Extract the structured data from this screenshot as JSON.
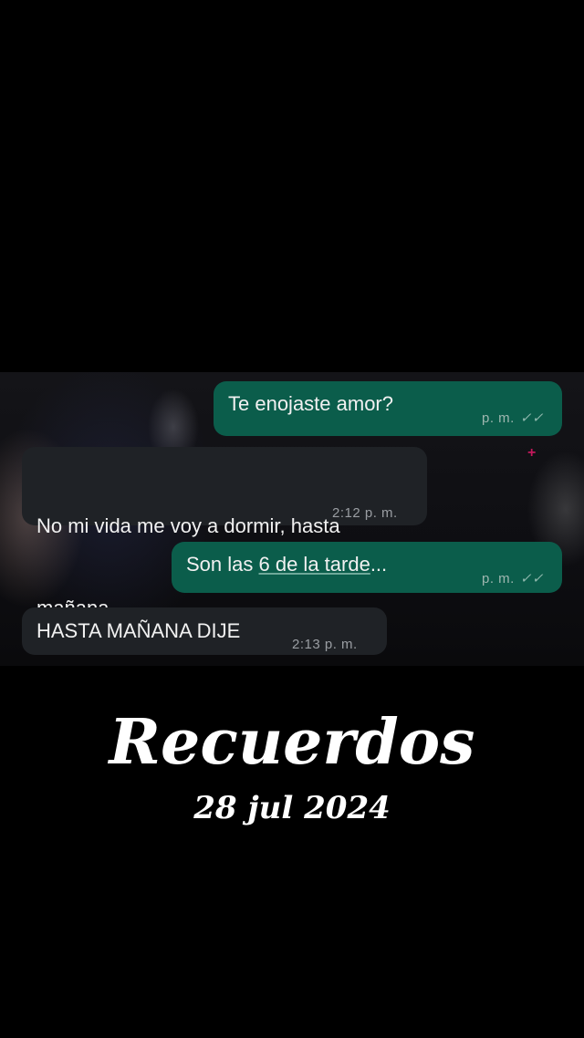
{
  "chat": {
    "messages": [
      {
        "direction": "outgoing",
        "text": "Te enojaste amor?",
        "time": "p. m.",
        "status_icon": "double-check-icon"
      },
      {
        "direction": "incoming",
        "line1": "No mi vida me voy a dormir, hasta",
        "line2": "mañana.",
        "time": "2:12 p. m."
      },
      {
        "direction": "outgoing",
        "text_before": "Son las ",
        "link_text": "6 de la tarde",
        "text_after": "...",
        "time": "p. m.",
        "status_icon": "double-check-icon"
      },
      {
        "direction": "incoming",
        "text": "HASTA MAÑANA DIJE",
        "time": "2:13 p. m."
      }
    ],
    "tick_glyph": "✓✓",
    "colors": {
      "outgoing_bubble": "#0b5d4b",
      "incoming_bubble": "#1f2226",
      "background": "#000000"
    }
  },
  "overlay": {
    "title": "Recuerdos",
    "date": "28 jul 2024"
  }
}
